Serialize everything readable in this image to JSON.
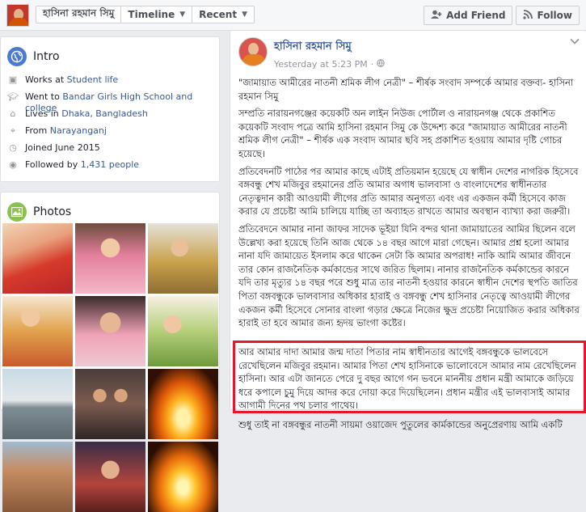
{
  "topbar": {
    "profile_name": "হাসিনা রহমান সিমু",
    "tab_timeline": "Timeline",
    "tab_recent": "Recent",
    "add_friend": "Add Friend",
    "follow": "Follow"
  },
  "intro": {
    "title": "Intro",
    "items": [
      {
        "prefix": "Works at ",
        "link": "Student life",
        "suffix": ""
      },
      {
        "prefix": "Went to ",
        "link": "Bandar Girls High School and college",
        "suffix": ""
      },
      {
        "prefix": "Lives in ",
        "link": "Dhaka, Bangladesh",
        "suffix": ""
      },
      {
        "prefix": "From ",
        "link": "Narayanganj",
        "suffix": ""
      },
      {
        "prefix": "Joined June 2015",
        "link": "",
        "suffix": ""
      },
      {
        "prefix": "Followed by ",
        "link": "1,431 people",
        "suffix": ""
      }
    ]
  },
  "photos": {
    "title": "Photos"
  },
  "post": {
    "author": "হাসিনা রহমান সিমু",
    "timestamp": "Yesterday at 5:23 PM",
    "paragraphs": [
      "\"জামায়াত আমীরের নাতনী শ্রমিক লীগ নেত্রী\" – শীর্ষক সংবাদ সম্পর্কে আমার বক্তব্য- হাসিনা রহমান সিমু",
      "সম্প্রতি নারায়নগঞ্জের কয়েকটি অন লাইন নিউজ পোর্টাল ও নারায়নগঞ্জ থেকে প্রকাশিত কয়েকটি সংবাদ পত্রে আমি হাসিনা রহমান সিমু কে উদ্দেশ্য করে \"জামায়াত আমীরের নাতনী শ্রমিক লীগ নেত্রী\" – শীর্ষক এক সংবাদ আমার ছবি সহ প্রকাশিত হওয়ায় আমার দৃষ্টি গোচর হয়েছে।",
      "প্রতিবেদনটি পাঠের পর আমার কাছে এটাই প্রতিয়মান হয়েছে যে স্বাধীন দেশের নাগরিক হিসেবে বঙ্গবন্ধু শেখ মজিবুর রহমানের প্রতি আমার অগাধ ভালবাসা ও বাংলাদেশের স্বাধীনতার নেতৃত্বদান কারী আওয়ামী লীগের প্রতি আমার অনুগত্য এবং এর একজন কর্মী হিসেবে কাজ করার যে প্রচেষ্টা আমি চালিয়ে যাচ্ছি তা অব্যাহত রাখতে আমার অবস্থান ব্যাখ্যা করা জরুরী।",
      "প্রতিবেদনে আমার নানা জাফর সাদেক ভূইয়া যিনি বন্দর থানা জামায়াতের আমির ছিলেন বলে উল্লেখ্য করা হয়েছে তিনি আজ থেকে ১৪ বছর আগে মারা গেছেন। আমার প্রশ্ন হলো আমার নানা যদি জামায়েত ইসলাম করে থাকেন সেটা কি আমার অপরাধ! নাকি আমি আমার জীবনে তার কোন রাজনৈতিক কর্মকান্ডের সাথে জরিত ছিলাম। নানার রাজনৈতিক কর্মকান্ডের কারনে যদি তার মৃত্যুর ১৪ বছর পরে শুধু মাত্র তার নাতনী হওয়ার কারনে স্বাধীন দেশের স্থপতি জাতির পিতা বঙ্গবন্ধুকে ভালবাসার অধিকার হারাই ও বঙ্গবন্ধু শেখ হাসিনার নেতৃত্বে আওয়ামী লীগের একজন কর্মী হিসেবে সোনার বাংলা গড়ার ক্ষেত্রে নিজের ক্ষুদ্র প্রচেষ্টা নিয়োজিত করার অধিকার হারাই তা হবে আমার জন্য হৃদয় ভাংগা কষ্টের।"
    ],
    "highlighted": "আর আমার দাদা আমার জন্ম দাতা পিতার নাম স্বাধীনতার আগেই বঙ্গবন্ধুকে ভালবেসে রেখেছিলেন মজিবুর রহমান। আমার পিতা শেখ হাসিনাকে ভালোবেসে আমার নাম রেখেছিলেন হাসিনা। আর এটা জানতে পেরে দু বছর আগে গন ভবনে মাননীয় প্রধান মন্ত্রী আমাকে জড়িয়ে ধরে কপালে চুমু দিয়ে আদর করে দোয়া করে দিয়েছিলেন। প্রধান মন্ত্রীর এই ভালবাসাই আমার আগামী দিনের পথ চলার পাথেয়।",
    "tail": "শুধু তাই না বঙ্গবন্ধুর নাতনী সায়মা ওয়াজেদ পুতুলের কার্মকান্ডের অনুপ্রেরণায় আমি একটি"
  },
  "colors": {
    "link": "#365899",
    "highlight_border": "#e4172b",
    "intro_icon": "#4b7bd1",
    "photos_icon": "#8cc152"
  },
  "icons": [
    "briefcase-icon",
    "graduation-icon",
    "home-icon",
    "location-icon",
    "clock-icon",
    "rss-icon",
    "globe-icon"
  ]
}
